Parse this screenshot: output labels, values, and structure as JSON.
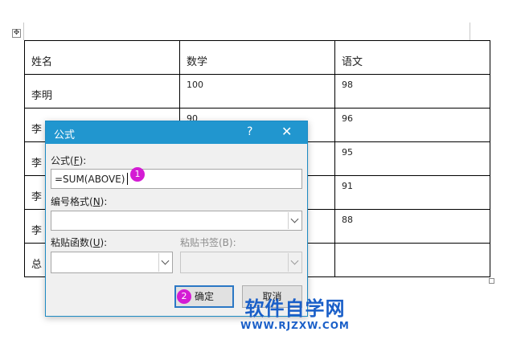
{
  "table": {
    "header": [
      "姓名",
      "数学",
      "语文"
    ],
    "rows": [
      {
        "name": "李明",
        "math": "100",
        "chinese": "98"
      },
      {
        "name": "李",
        "math": "90",
        "chinese": "96"
      },
      {
        "name": "李",
        "math": "",
        "chinese": "95"
      },
      {
        "name": "李",
        "math": "",
        "chinese": "91"
      },
      {
        "name": "李",
        "math": "",
        "chinese": "88"
      },
      {
        "name": "总",
        "math": "",
        "chinese": ""
      }
    ]
  },
  "dialog": {
    "title": "公式",
    "help": "?",
    "close": "✕",
    "formula_label_text": "公式(",
    "formula_label_key": "F",
    "formula_label_end": "):",
    "formula_value": "=SUM(ABOVE)",
    "number_format_label_text": "编号格式(",
    "number_format_label_key": "N",
    "number_format_label_end": "):",
    "number_format_value": "",
    "paste_function_label_text": "粘贴函数(",
    "paste_function_label_key": "U",
    "paste_function_label_end": "):",
    "paste_function_value": "",
    "paste_bookmark_label": "粘贴书签(B):",
    "paste_bookmark_value": "",
    "ok_button": "确定",
    "cancel_button": "取消"
  },
  "annotations": {
    "badge1": "1",
    "badge2": "2"
  },
  "watermark": {
    "title": "软件自学网",
    "url": "WWW.RJZXW.COM"
  },
  "colors": {
    "titlebar": "#2196cf",
    "badge": "#d41cd4",
    "watermark": "#1a5fc8"
  }
}
